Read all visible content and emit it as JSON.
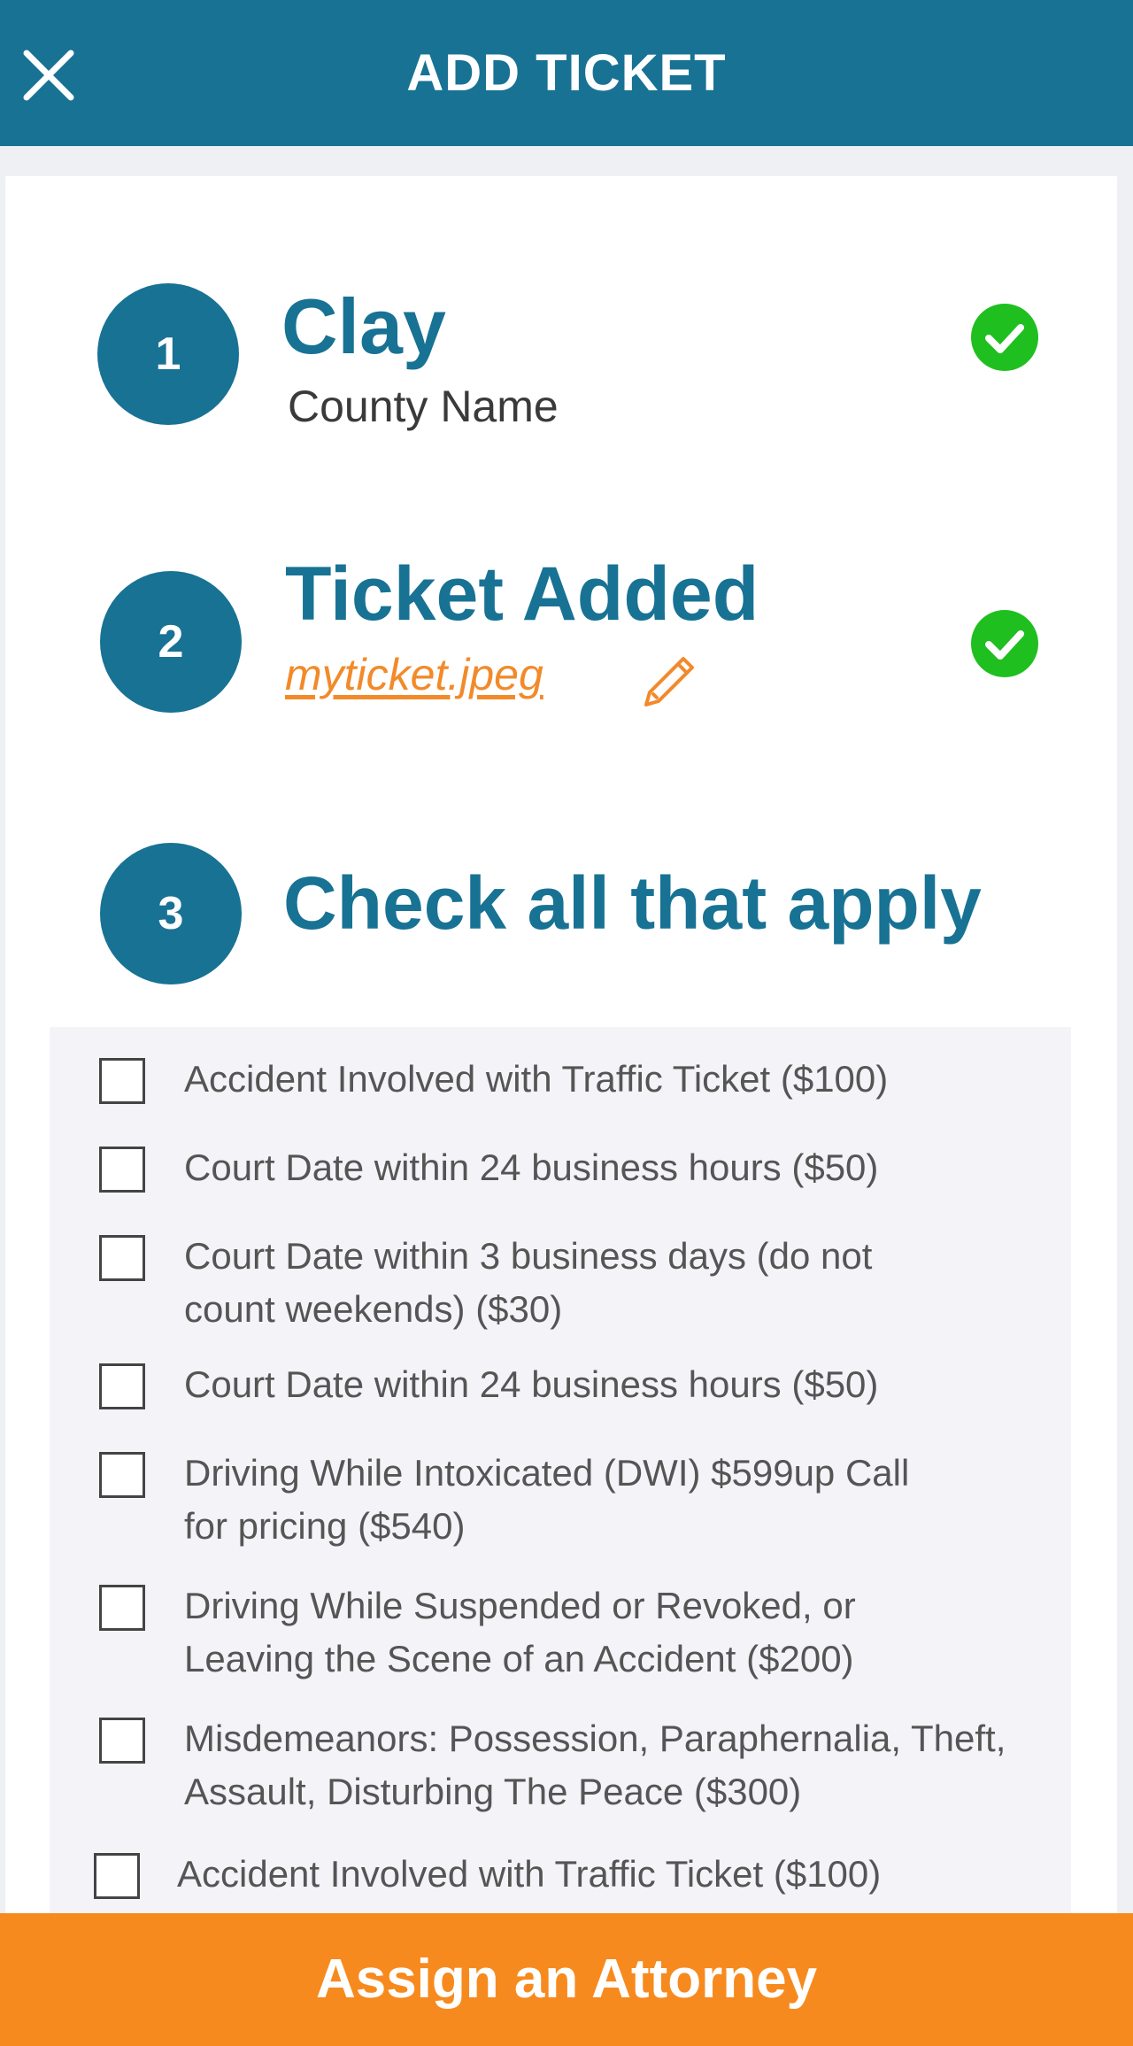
{
  "header": {
    "title": "ADD TICKET",
    "close_icon": "close-icon"
  },
  "steps": [
    {
      "number": "1",
      "title": "Clay",
      "subtitle": "County Name",
      "status_icon": "check-circle-icon"
    },
    {
      "number": "2",
      "title": "Ticket Added",
      "file_name": "myticket.jpeg",
      "edit_icon": "pencil-icon",
      "status_icon": "check-circle-icon"
    },
    {
      "number": "3",
      "title": "Check all that apply"
    }
  ],
  "options": [
    {
      "label": "Accident Involved with Traffic Ticket ($100)",
      "checked": false
    },
    {
      "label": "Court Date within 24 business hours ($50)",
      "checked": false
    },
    {
      "label": "Court Date within 3 business days (do not count weekends) ($30)",
      "checked": false
    },
    {
      "label": "Court Date within 24 business hours ($50)",
      "checked": false
    },
    {
      "label": "Driving While Intoxicated (DWI) $599up Call for pricing ($540)",
      "checked": false
    },
    {
      "label": "Driving While Suspended or Revoked, or Leaving the Scene of an Accident ($200)",
      "checked": false
    },
    {
      "label": "Misdemeanors: Possession, Paraphernalia, Theft, Assault, Disturbing The Peace ($300)",
      "checked": false
    },
    {
      "label": "Accident Involved with Traffic Ticket ($100)",
      "checked": false
    }
  ],
  "footer": {
    "button_label": "Assign an Attorney"
  },
  "colors": {
    "primary": "#187294",
    "accent": "#f78a1e",
    "success": "#1fbf1f"
  }
}
